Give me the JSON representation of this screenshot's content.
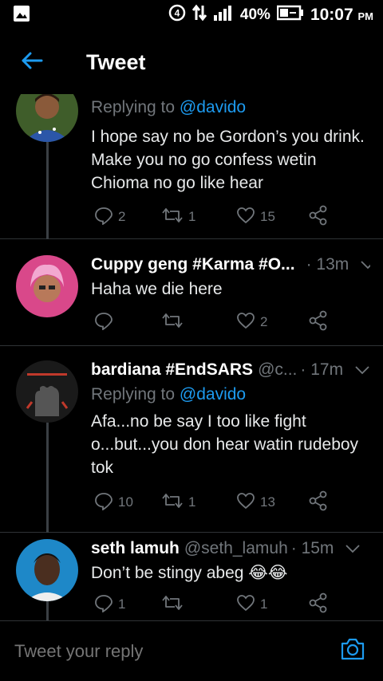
{
  "status_bar": {
    "battery": "40%",
    "time": "10:07",
    "ampm": "PM"
  },
  "header": {
    "title": "Tweet"
  },
  "tweets": [
    {
      "name": "",
      "handle": "",
      "time": "",
      "replying_prefix": "Replying to ",
      "replying_to": "@davido",
      "text": "I hope say no be Gordon’s you drink. Make you no go confess wetin Chioma no go like hear",
      "replies": "2",
      "retweets": "1",
      "likes": "15"
    },
    {
      "name": "Cuppy geng #Karma #O...",
      "handle": "",
      "time": "· 13m",
      "replying_prefix": "",
      "replying_to": "",
      "text": "Haha we die here",
      "replies": "",
      "retweets": "",
      "likes": "2"
    },
    {
      "name": "bardiana #EndSARS",
      "handle": "@c...",
      "time": "· 17m",
      "replying_prefix": "Replying to ",
      "replying_to": "@davido",
      "text": "Afa...no be say I too like fight o...but...you don hear watin rudeboy tok",
      "replies": "10",
      "retweets": "1",
      "likes": "13"
    },
    {
      "name": "seth lamuh",
      "handle": "@seth_lamuh",
      "time": "· 15m",
      "replying_prefix": "",
      "replying_to": "",
      "text": "Don’t be stingy abeg 😂😂",
      "replies": "1",
      "retweets": "",
      "likes": "1"
    }
  ],
  "composer": {
    "placeholder": "Tweet your reply"
  },
  "colors": {
    "accent": "#1d9bf0",
    "muted": "#71767b",
    "background": "#000000"
  }
}
